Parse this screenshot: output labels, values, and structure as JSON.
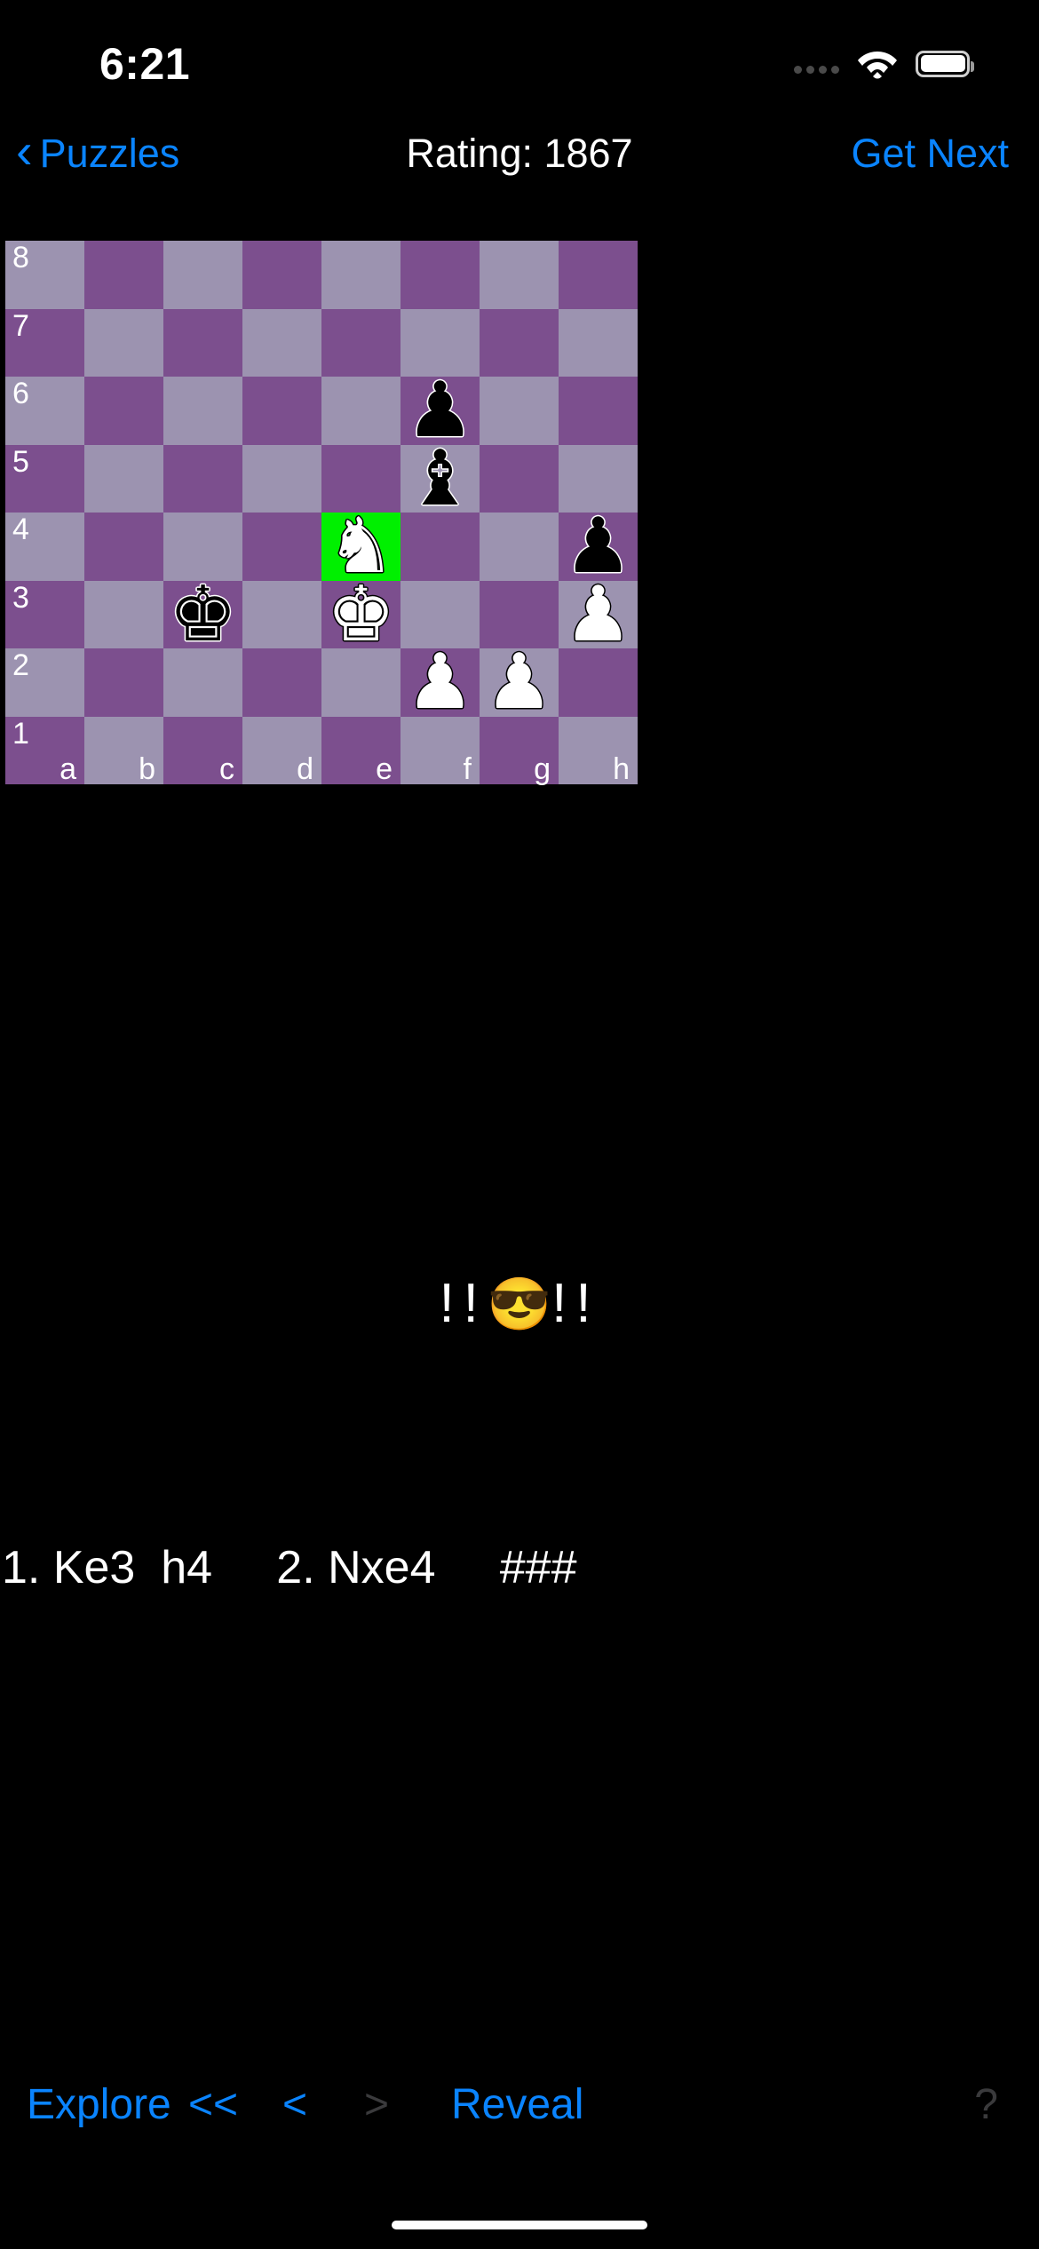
{
  "status_bar": {
    "time": "6:21",
    "signal_icon": "signal-dots-icon",
    "wifi_icon": "wifi-icon",
    "battery_icon": "battery-full-icon"
  },
  "nav_bar": {
    "back_icon": "chevron-left-icon",
    "back_label": "Puzzles",
    "title": "Rating: 1867",
    "next_label": "Get Next"
  },
  "board": {
    "highlight_square": "e4",
    "highlight_color": "#00f000",
    "light_color": "#9c93b0",
    "dark_color": "#7c4f8e",
    "rank_labels": [
      "8",
      "7",
      "6",
      "5",
      "4",
      "3",
      "2",
      "1"
    ],
    "file_labels": [
      "a",
      "b",
      "c",
      "d",
      "e",
      "f",
      "g",
      "h"
    ],
    "pieces": [
      {
        "square": "f6",
        "glyph": "♟",
        "color": "black",
        "name": "black-pawn"
      },
      {
        "square": "f5",
        "glyph": "♝",
        "color": "black",
        "name": "black-bishop"
      },
      {
        "square": "e4",
        "glyph": "♞",
        "color": "white",
        "name": "white-knight"
      },
      {
        "square": "h4",
        "glyph": "♟",
        "color": "black",
        "name": "black-pawn"
      },
      {
        "square": "c3",
        "glyph": "♚",
        "color": "black",
        "name": "black-king"
      },
      {
        "square": "e3",
        "glyph": "♚",
        "color": "white",
        "name": "white-king"
      },
      {
        "square": "h3",
        "glyph": "♟",
        "color": "white",
        "name": "white-pawn"
      },
      {
        "square": "f2",
        "glyph": "♟",
        "color": "white",
        "name": "white-pawn"
      },
      {
        "square": "g2",
        "glyph": "♟",
        "color": "white",
        "name": "white-pawn"
      }
    ]
  },
  "annotation": {
    "left": "!!",
    "emoji": "😎",
    "right": "!!"
  },
  "move_list": {
    "text": "1. Ke3  h4     2. Nxe4     ###"
  },
  "toolbar": {
    "explore": "Explore",
    "first": "<<",
    "prev": "<",
    "next": ">",
    "reveal": "Reveal",
    "help": "?"
  }
}
